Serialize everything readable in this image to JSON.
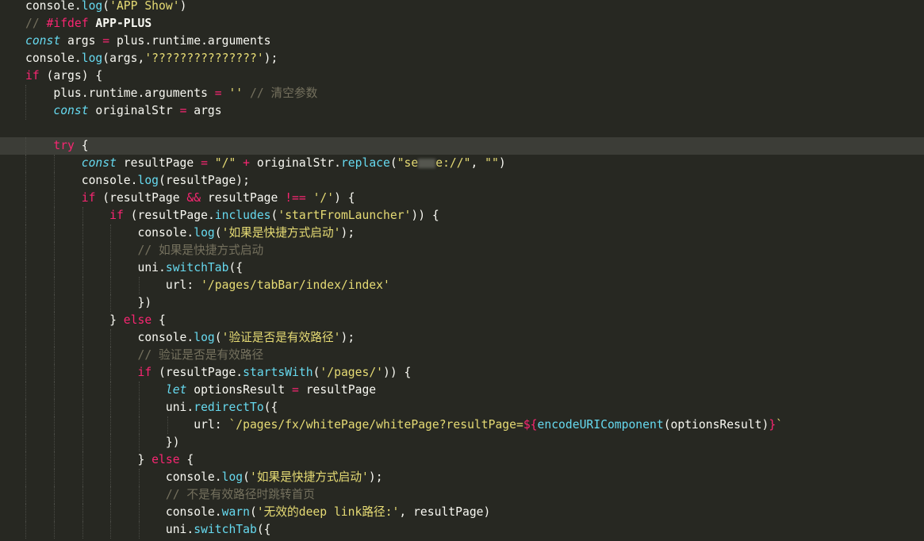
{
  "editor": {
    "lines": [
      [
        {
          "t": "console",
          "c": "p"
        },
        {
          "t": ".",
          "c": "p"
        },
        {
          "t": "log",
          "c": "f"
        },
        {
          "t": "(",
          "c": "p"
        },
        {
          "t": "'APP Show'",
          "c": "s"
        },
        {
          "t": ")",
          "c": "p"
        }
      ],
      [
        {
          "t": "// ",
          "c": "c"
        },
        {
          "t": "#ifdef",
          "c": "pp"
        },
        {
          "t": " APP-PLUS",
          "c": "ppb"
        }
      ],
      [
        {
          "t": "const",
          "c": "st"
        },
        {
          "t": " args ",
          "c": "p"
        },
        {
          "t": "=",
          "c": "op"
        },
        {
          "t": " plus.runtime.arguments",
          "c": "p"
        }
      ],
      [
        {
          "t": "console",
          "c": "p"
        },
        {
          "t": ".",
          "c": "p"
        },
        {
          "t": "log",
          "c": "f"
        },
        {
          "t": "(args,",
          "c": "p"
        },
        {
          "t": "'???????????????'",
          "c": "s"
        },
        {
          "t": ");",
          "c": "p"
        }
      ],
      [
        {
          "t": "if",
          "c": "k"
        },
        {
          "t": " (args) {",
          "c": "p"
        }
      ],
      [
        {
          "t": "    plus.runtime.arguments ",
          "c": "p"
        },
        {
          "t": "=",
          "c": "op"
        },
        {
          "t": " ",
          "c": "p"
        },
        {
          "t": "''",
          "c": "s"
        },
        {
          "t": " // 清空参数",
          "c": "c"
        }
      ],
      [
        {
          "t": "    ",
          "c": "p"
        },
        {
          "t": "const",
          "c": "st"
        },
        {
          "t": " originalStr ",
          "c": "p"
        },
        {
          "t": "=",
          "c": "op"
        },
        {
          "t": " args",
          "c": "p"
        }
      ],
      [],
      [
        {
          "t": "    ",
          "c": "p"
        },
        {
          "t": "try",
          "c": "k"
        },
        {
          "t": " {",
          "c": "p"
        }
      ],
      [
        {
          "t": "        ",
          "c": "p"
        },
        {
          "t": "const",
          "c": "st"
        },
        {
          "t": " resultPage ",
          "c": "p"
        },
        {
          "t": "=",
          "c": "op"
        },
        {
          "t": " ",
          "c": "p"
        },
        {
          "t": "\"/\"",
          "c": "s"
        },
        {
          "t": " ",
          "c": "p"
        },
        {
          "t": "+",
          "c": "op"
        },
        {
          "t": " originalStr",
          "c": "p"
        },
        {
          "t": ".",
          "c": "p"
        },
        {
          "t": "replace",
          "c": "f"
        },
        {
          "t": "(",
          "c": "p"
        },
        {
          "t": "\"se",
          "c": "s"
        },
        {
          "t": "BLUR",
          "c": "blur"
        },
        {
          "t": "e://\"",
          "c": "s"
        },
        {
          "t": ", ",
          "c": "p"
        },
        {
          "t": "\"\"",
          "c": "s"
        },
        {
          "t": ")",
          "c": "p"
        }
      ],
      [
        {
          "t": "        console",
          "c": "p"
        },
        {
          "t": ".",
          "c": "p"
        },
        {
          "t": "log",
          "c": "f"
        },
        {
          "t": "(resultPage);",
          "c": "p"
        }
      ],
      [
        {
          "t": "        ",
          "c": "p"
        },
        {
          "t": "if",
          "c": "k"
        },
        {
          "t": " (resultPage ",
          "c": "p"
        },
        {
          "t": "&&",
          "c": "op"
        },
        {
          "t": " resultPage ",
          "c": "p"
        },
        {
          "t": "!==",
          "c": "op"
        },
        {
          "t": " ",
          "c": "p"
        },
        {
          "t": "'/'",
          "c": "s"
        },
        {
          "t": ") {",
          "c": "p"
        }
      ],
      [
        {
          "t": "            ",
          "c": "p"
        },
        {
          "t": "if",
          "c": "k"
        },
        {
          "t": " (resultPage",
          "c": "p"
        },
        {
          "t": ".",
          "c": "p"
        },
        {
          "t": "includes",
          "c": "f"
        },
        {
          "t": "(",
          "c": "p"
        },
        {
          "t": "'startFromLauncher'",
          "c": "s"
        },
        {
          "t": ")) {",
          "c": "p"
        }
      ],
      [
        {
          "t": "                console",
          "c": "p"
        },
        {
          "t": ".",
          "c": "p"
        },
        {
          "t": "log",
          "c": "f"
        },
        {
          "t": "(",
          "c": "p"
        },
        {
          "t": "'如果是快捷方式启动'",
          "c": "s"
        },
        {
          "t": ");",
          "c": "p"
        }
      ],
      [
        {
          "t": "                ",
          "c": "p"
        },
        {
          "t": "// 如果是快捷方式启动",
          "c": "c"
        }
      ],
      [
        {
          "t": "                uni",
          "c": "p"
        },
        {
          "t": ".",
          "c": "p"
        },
        {
          "t": "switchTab",
          "c": "f"
        },
        {
          "t": "({",
          "c": "p"
        }
      ],
      [
        {
          "t": "                    url: ",
          "c": "p"
        },
        {
          "t": "'/pages/tabBar/index/index'",
          "c": "s"
        }
      ],
      [
        {
          "t": "                })",
          "c": "p"
        }
      ],
      [
        {
          "t": "            } ",
          "c": "p"
        },
        {
          "t": "else",
          "c": "k"
        },
        {
          "t": " {",
          "c": "p"
        }
      ],
      [
        {
          "t": "                console",
          "c": "p"
        },
        {
          "t": ".",
          "c": "p"
        },
        {
          "t": "log",
          "c": "f"
        },
        {
          "t": "(",
          "c": "p"
        },
        {
          "t": "'验证是否是有效路径'",
          "c": "s"
        },
        {
          "t": ");",
          "c": "p"
        }
      ],
      [
        {
          "t": "                ",
          "c": "p"
        },
        {
          "t": "// 验证是否是有效路径",
          "c": "c"
        }
      ],
      [
        {
          "t": "                ",
          "c": "p"
        },
        {
          "t": "if",
          "c": "k"
        },
        {
          "t": " (resultPage",
          "c": "p"
        },
        {
          "t": ".",
          "c": "p"
        },
        {
          "t": "startsWith",
          "c": "f"
        },
        {
          "t": "(",
          "c": "p"
        },
        {
          "t": "'/pages/'",
          "c": "s"
        },
        {
          "t": ")) {",
          "c": "p"
        }
      ],
      [
        {
          "t": "                    ",
          "c": "p"
        },
        {
          "t": "let",
          "c": "st"
        },
        {
          "t": " optionsResult ",
          "c": "p"
        },
        {
          "t": "=",
          "c": "op"
        },
        {
          "t": " resultPage",
          "c": "p"
        }
      ],
      [
        {
          "t": "                    uni",
          "c": "p"
        },
        {
          "t": ".",
          "c": "p"
        },
        {
          "t": "redirectTo",
          "c": "f"
        },
        {
          "t": "({",
          "c": "p"
        }
      ],
      [
        {
          "t": "                        url: ",
          "c": "p"
        },
        {
          "t": "`/pages/fx/whitePage/whitePage?resultPage=",
          "c": "s"
        },
        {
          "t": "${",
          "c": "interp"
        },
        {
          "t": "encodeURIComponent",
          "c": "f"
        },
        {
          "t": "(optionsResult)",
          "c": "p"
        },
        {
          "t": "}",
          "c": "interp"
        },
        {
          "t": "`",
          "c": "s"
        }
      ],
      [
        {
          "t": "                    })",
          "c": "p"
        }
      ],
      [
        {
          "t": "                } ",
          "c": "p"
        },
        {
          "t": "else",
          "c": "k"
        },
        {
          "t": " {",
          "c": "p"
        }
      ],
      [
        {
          "t": "                    console",
          "c": "p"
        },
        {
          "t": ".",
          "c": "p"
        },
        {
          "t": "log",
          "c": "f"
        },
        {
          "t": "(",
          "c": "p"
        },
        {
          "t": "'如果是快捷方式启动'",
          "c": "s"
        },
        {
          "t": ");",
          "c": "p"
        }
      ],
      [
        {
          "t": "                    ",
          "c": "p"
        },
        {
          "t": "// 不是有效路径时跳转首页",
          "c": "c"
        }
      ],
      [
        {
          "t": "                    console",
          "c": "p"
        },
        {
          "t": ".",
          "c": "p"
        },
        {
          "t": "warn",
          "c": "f"
        },
        {
          "t": "(",
          "c": "p"
        },
        {
          "t": "'无效的deep link路径:'",
          "c": "s"
        },
        {
          "t": ", resultPage)",
          "c": "p"
        }
      ],
      [
        {
          "t": "                    uni",
          "c": "p"
        },
        {
          "t": ".",
          "c": "p"
        },
        {
          "t": "switchTab",
          "c": "f"
        },
        {
          "t": "({",
          "c": "p"
        }
      ]
    ],
    "active_line": 8
  }
}
